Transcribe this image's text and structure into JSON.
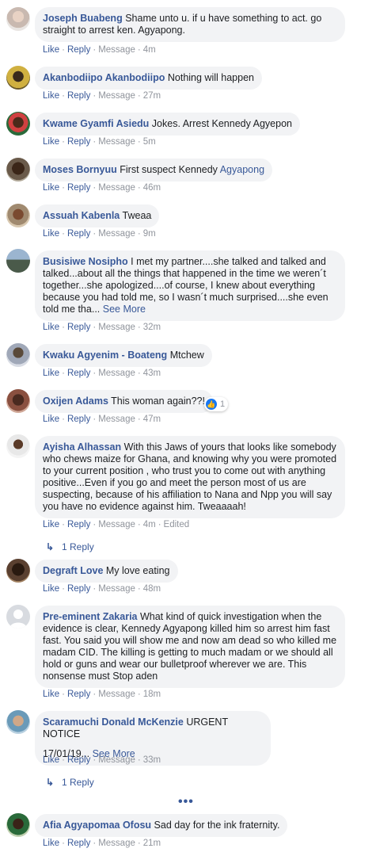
{
  "actions": {
    "like": "Like",
    "reply": "Reply",
    "message": "Message",
    "dot": "·"
  },
  "see_more": "See More",
  "comments": [
    {
      "author": "Joseph Buabeng",
      "text": "Shame unto u. if u have something to act. go straight to arrest ken. Agyapong.",
      "time": "4m"
    },
    {
      "author": "Akanbodiipo Akanbodiipo",
      "text": "Nothing will happen",
      "time": "27m"
    },
    {
      "author": "Kwame Gyamfi Asiedu",
      "text": "Jokes. Arrest Kennedy Agyepon",
      "time": "5m"
    },
    {
      "author": "Moses Bornyuu",
      "text": "First suspect Kennedy",
      "mention": "Agyapong",
      "time": "46m"
    },
    {
      "author": "Assuah Kabenla",
      "text": "Tweaa",
      "time": "9m"
    },
    {
      "author": "Busisiwe Nosipho",
      "text": "I met my partner....she talked and talked and talked...about all the things that happened in the time we weren´t together...she apologized....of course, I knew about everything because you had told me, so I wasn´t much surprised....she even told me tha...",
      "time": "32m"
    },
    {
      "author": "Kwaku Agyenim - Boateng",
      "text": "Mtchew",
      "time": "43m"
    },
    {
      "author": "Oxijen Adams",
      "text": "This woman again??!",
      "time": "47m",
      "reactions": "1"
    },
    {
      "author": "Ayisha Alhassan",
      "text": "With this Jaws of yours that looks like somebody who chews maize for Ghana, and knowing why you were promoted to your current position , who trust you to come out with anything positive...Even if you go and meet the person most of us are suspecting, because of his affiliation to Nana and Npp you will say you have no evidence against him. Tweaaaah!",
      "time": "4m",
      "edited": "Edited",
      "replies": "1 Reply"
    },
    {
      "author": "Degraft Love",
      "text": "My love eating",
      "time": "48m"
    },
    {
      "author": "Pre-eminent Zakaria",
      "text": "What kind of quick investigation when the evidence is clear, Kennedy Agyapong killed him so arrest him fast fast. You said you will show me and now am dead so who killed me madam CID. The killing is getting to much madam or we should all hold or guns and wear our bulletproof wherever we are. This nonsense must Stop aden",
      "time": "18m"
    },
    {
      "author": "Scaramuchi Donald McKenzie",
      "text": "URGENT NOTICE",
      "text2": "17/01/19...",
      "time": "33m",
      "replies": "1 Reply"
    },
    {
      "author": "Afia Agyapomaa Ofosu",
      "text": "Sad day for the ink fraternity.",
      "time": "21m"
    }
  ],
  "more_comments": "•••",
  "colors": {
    "link": "#385898",
    "bubble": "#f2f3f5",
    "meta": "#90949c",
    "like_badge": "#1877f2"
  },
  "icons": [
    "avatar",
    "reply-arrow-icon",
    "like-reaction-icon"
  ]
}
